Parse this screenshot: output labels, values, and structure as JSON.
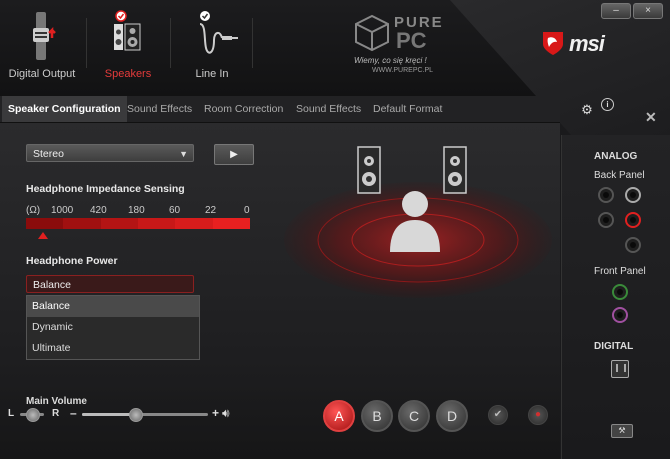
{
  "devices": [
    {
      "label": "Digital Output",
      "icon": "digital-output-icon",
      "active": false
    },
    {
      "label": "Speakers",
      "icon": "speakers-icon",
      "active": true
    },
    {
      "label": "Line In",
      "icon": "line-in-icon",
      "active": false
    }
  ],
  "brand": {
    "pure": "PURE",
    "pc": "PC",
    "slogan": "Wiemy, co się kręci !",
    "url": "WWW.PUREPC.PL",
    "msi": "msi",
    "accent": "#e02020"
  },
  "window": {
    "minimize": "–",
    "close": "×"
  },
  "tabs": [
    {
      "label": "Speaker Configuration",
      "active": true
    },
    {
      "label": "Sound Effects",
      "active": false
    },
    {
      "label": "Room Correction",
      "active": false
    },
    {
      "label": "Sound Effects",
      "active": false
    },
    {
      "label": "Default Format",
      "active": false
    }
  ],
  "config": {
    "speaker_mode": "Stereo",
    "play_glyph": "▶"
  },
  "impedance": {
    "title": "Headphone Impedance Sensing",
    "unit": "(Ω)",
    "scale": [
      "1000",
      "420",
      "180",
      "60",
      "22",
      "0"
    ]
  },
  "headphone_power": {
    "title": "Headphone Power",
    "selected": "Balance",
    "options": [
      "Balance",
      "Dynamic",
      "Ultimate"
    ]
  },
  "volume": {
    "title": "Main Volume",
    "left": "L",
    "right": "R",
    "minus": "–",
    "plus": "+",
    "balance_level": 0.5,
    "level": 0.42
  },
  "presets": [
    "A",
    "B",
    "C",
    "D"
  ],
  "right_panel": {
    "analog": "ANALOG",
    "back_panel": "Back Panel",
    "front_panel": "Front Panel",
    "digital": "DIGITAL"
  }
}
